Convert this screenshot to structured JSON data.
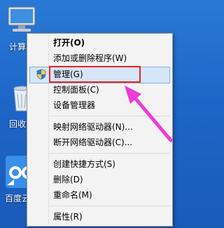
{
  "desktop": {
    "computer_label": "计算机",
    "recycle_label": "回收站",
    "baidu_label": "百度云管"
  },
  "menu": {
    "items": [
      {
        "label": "打开(O)"
      },
      {
        "label": "添加或删除程序(W)"
      },
      {
        "label": "管理(G)"
      },
      {
        "label": "控制面板(C)"
      },
      {
        "label": "设备管理器"
      },
      {
        "label": "映射网络驱动器(N)..."
      },
      {
        "label": "断开网络驱动器(C)..."
      },
      {
        "label": "创建快捷方式(S)"
      },
      {
        "label": "删除(D)"
      },
      {
        "label": "重命名(M)"
      },
      {
        "label": "属性(R)"
      }
    ]
  },
  "colors": {
    "highlight_box": "#f0221e",
    "arrow": "#ee3bd9",
    "desktop": "#1d66c7"
  }
}
